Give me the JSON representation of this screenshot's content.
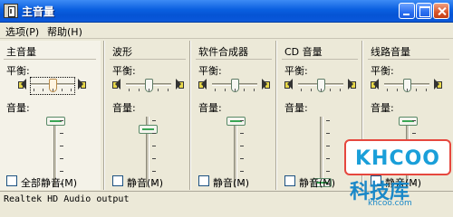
{
  "window": {
    "title": "主音量"
  },
  "menu": {
    "options": "选项(P)",
    "help": "帮助(H)"
  },
  "labels": {
    "balance": "平衡:",
    "volume": "音量:"
  },
  "channels": [
    {
      "name": "主音量",
      "mute_label": "全部静音(M)",
      "muted": false,
      "balance_pct": 50,
      "volume_pct": 80
    },
    {
      "name": "波形",
      "mute_label": "静音(M)",
      "muted": false,
      "balance_pct": 50,
      "volume_pct": 70
    },
    {
      "name": "软件合成器",
      "mute_label": "静音(M)",
      "muted": false,
      "balance_pct": 50,
      "volume_pct": 80
    },
    {
      "name": "CD 音量",
      "mute_label": "静音(M)",
      "muted": false,
      "balance_pct": 50,
      "volume_pct": 15
    },
    {
      "name": "线路音量",
      "mute_label": "静音(M)",
      "muted": false,
      "balance_pct": 50,
      "volume_pct": 80
    }
  ],
  "status": {
    "text": "Realtek HD Audio output"
  },
  "watermark": {
    "logo": "KHCOO",
    "name": "科技库",
    "url": "khcoo.com"
  },
  "colors": {
    "titlebar": "#0a5fe0",
    "face": "#ece9d8",
    "thumb_accent": "#3aa655"
  },
  "icons": {
    "app": "volume-control-icon",
    "speaker": "speaker-icon"
  }
}
